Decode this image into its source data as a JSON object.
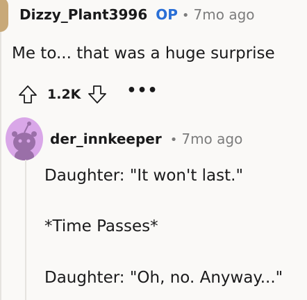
{
  "top_comment": {
    "author": "Dizzy_Plant3996",
    "op_badge": "OP",
    "separator": "•",
    "time": "7mo ago",
    "body": "Me to... that was a huge surprise",
    "vote_count": "1.2K",
    "more": "•••",
    "avatar_color": "#c8a979"
  },
  "reply": {
    "author": "der_innkeeper",
    "separator": "•",
    "time": "7mo ago",
    "lines": [
      "Daughter: \"It won't last.\"",
      "*Time Passes*",
      "Daughter: \"Oh, no. Anyway...\""
    ],
    "avatar_color": "#d9a7e8"
  },
  "colors": {
    "op": "#2a6fd6",
    "meta": "#7c7c7c",
    "text": "#1a1a1b",
    "background": "#faf9f7",
    "thread_line": "#e5e3df"
  }
}
